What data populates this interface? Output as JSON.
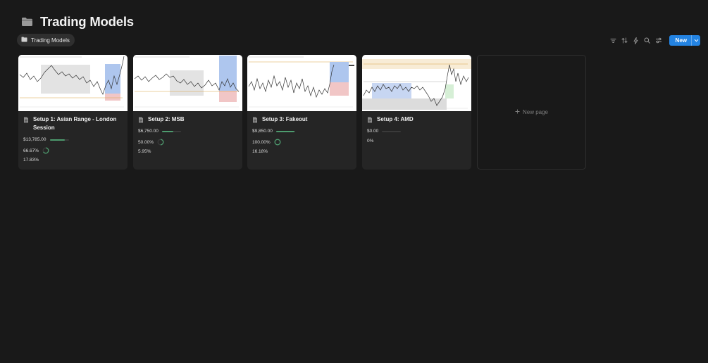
{
  "page": {
    "title": "Trading Models",
    "icon": "folder-icon"
  },
  "view_tab": {
    "label": "Trading Models",
    "icon": "folder-icon"
  },
  "toolbar": {
    "icons": [
      "filter-icon",
      "sort-icon",
      "lightning-icon",
      "search-icon",
      "settings-sliders-icon"
    ],
    "new_label": "New"
  },
  "cards": [
    {
      "title": "Setup 1: Asian Range - London Session",
      "amount": "$13,785.00",
      "amount_fraction": 0.8,
      "win_rate": "66.67%",
      "win_rate_fraction": 0.6667,
      "percent": "17.83%"
    },
    {
      "title": "Setup 2: MSB",
      "amount": "$6,750.00",
      "amount_fraction": 0.6,
      "win_rate": "50.00%",
      "win_rate_fraction": 0.5,
      "percent": "5.95%"
    },
    {
      "title": "Setup 3: Fakeout",
      "amount": "$9,850.00",
      "amount_fraction": 0.95,
      "win_rate": "100.00%",
      "win_rate_fraction": 1.0,
      "percent": "16.18%"
    },
    {
      "title": "Setup 4: AMD",
      "amount": "$0.00",
      "amount_fraction": 0.0,
      "win_rate": "0%",
      "win_rate_fraction": null,
      "percent": null
    }
  ],
  "new_page": {
    "label": "New page",
    "icon": "plus-icon"
  },
  "colors": {
    "accent": "#2383e2",
    "progress": "#4d9b6e",
    "background": "#191919",
    "card": "#252525"
  }
}
